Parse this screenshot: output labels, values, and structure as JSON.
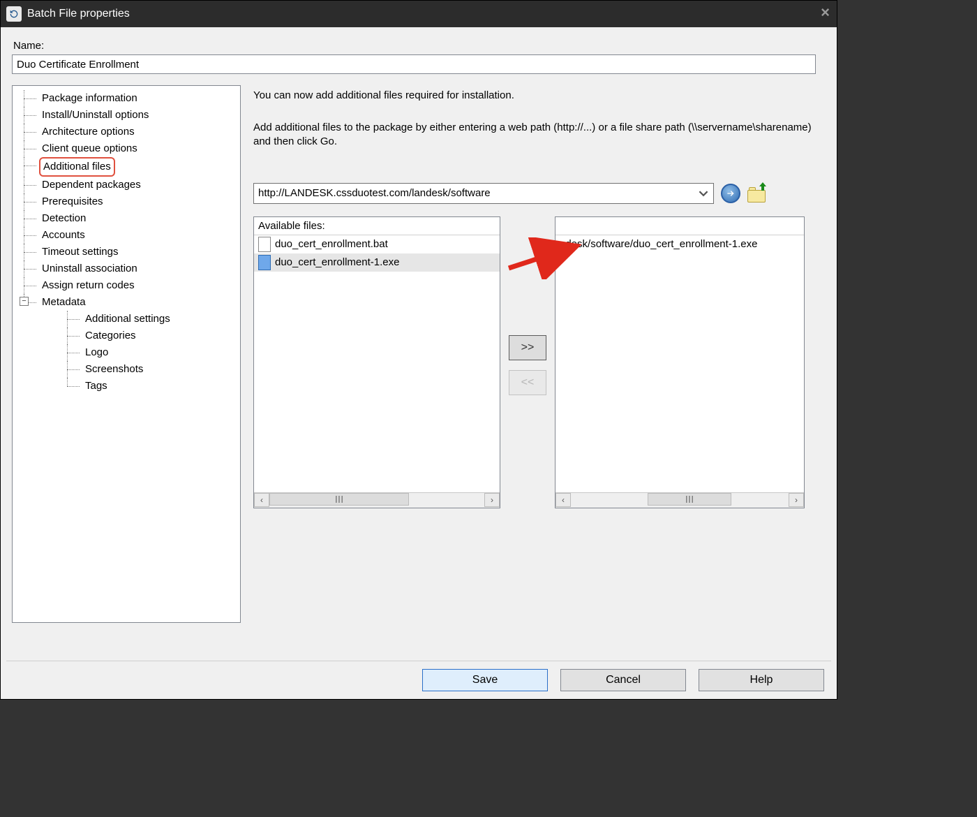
{
  "window": {
    "title": "Batch File properties"
  },
  "name_section": {
    "label": "Name:",
    "value": "Duo Certificate Enrollment"
  },
  "tree": {
    "items": [
      "Package information",
      "Install/Uninstall options",
      "Architecture options",
      "Client queue options",
      "Additional files",
      "Dependent packages",
      "Prerequisites",
      "Detection",
      "Accounts",
      "Timeout settings",
      "Uninstall association",
      "Assign return codes"
    ],
    "metadata_label": "Metadata",
    "metadata_children": [
      "Additional settings",
      "Categories",
      "Logo",
      "Screenshots",
      "Tags"
    ],
    "selected_index": 4
  },
  "right": {
    "intro1": "You can now add additional files required for installation.",
    "intro2": "Add additional files to the package by either entering a web path (http://...) or a file share path (\\\\servername\\sharename) and then click Go.",
    "path_value": "http://LANDESK.cssduotest.com/landesk/software",
    "available_header": "Available files:",
    "available_files": [
      {
        "name": "duo_cert_enrollment.bat",
        "selected": false
      },
      {
        "name": "duo_cert_enrollment-1.exe",
        "selected": true
      }
    ],
    "selected_files": [
      "ndesk/software/duo_cert_enrollment-1.exe"
    ],
    "move_add": ">>",
    "move_remove": "<<"
  },
  "buttons": {
    "save": "Save",
    "cancel": "Cancel",
    "help": "Help"
  },
  "scroll_glyph": "III"
}
